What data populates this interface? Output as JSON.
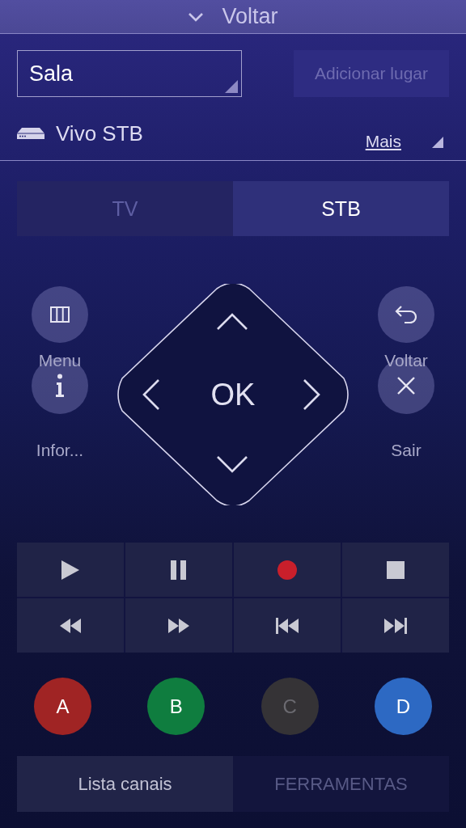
{
  "header": {
    "title": "Voltar"
  },
  "room_select": {
    "value": "Sala"
  },
  "add_place_button": {
    "label": "Adicionar lugar",
    "disabled": true
  },
  "device": {
    "name": "Vivo STB",
    "more_link": "Mais"
  },
  "tabs": [
    {
      "label": "TV",
      "selected": false
    },
    {
      "label": "STB",
      "selected": true
    }
  ],
  "side_buttons": [
    {
      "kind": "menu",
      "label": "Menu"
    },
    {
      "kind": "back",
      "label": "Voltar"
    },
    {
      "kind": "info",
      "label": "Infor..."
    },
    {
      "kind": "exit",
      "label": "Sair"
    }
  ],
  "dpad": {
    "center": "OK"
  },
  "media_buttons": [
    {
      "kind": "play"
    },
    {
      "kind": "pause"
    },
    {
      "kind": "record"
    },
    {
      "kind": "stop"
    },
    {
      "kind": "rewind"
    },
    {
      "kind": "fast-forward"
    },
    {
      "kind": "previous"
    },
    {
      "kind": "next"
    }
  ],
  "color_buttons": [
    {
      "label": "A",
      "color": "#a02424",
      "disabled": false
    },
    {
      "label": "B",
      "color": "#0f7d3f",
      "disabled": false
    },
    {
      "label": "C",
      "color": "#353336",
      "disabled": true
    },
    {
      "label": "D",
      "color": "#2d69c3",
      "disabled": false
    }
  ],
  "bottom_tabs": [
    {
      "label": "Lista canais",
      "selected": true
    },
    {
      "label": "FERRAMENTAS",
      "selected": false
    }
  ]
}
